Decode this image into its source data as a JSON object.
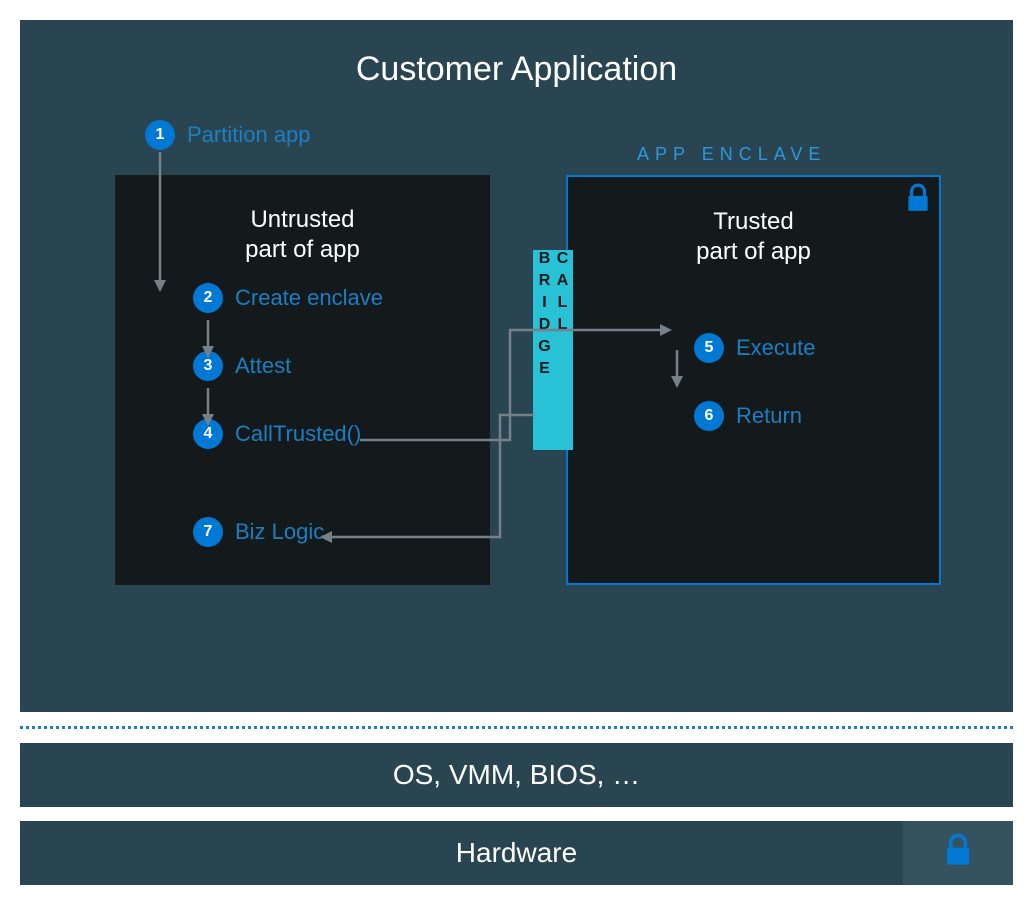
{
  "title": "Customer Application",
  "partition": {
    "num": "1",
    "label": "Partition app"
  },
  "untrusted": {
    "title_line1": "Untrusted",
    "title_line2": "part of app",
    "steps": [
      {
        "num": "2",
        "label": "Create enclave"
      },
      {
        "num": "3",
        "label": "Attest"
      },
      {
        "num": "4",
        "label": "CallTrusted()"
      },
      {
        "num": "7",
        "label": "Biz Logic"
      }
    ]
  },
  "trusted": {
    "enclave_label": "APP ENCLAVE",
    "title_line1": "Trusted",
    "title_line2": "part of app",
    "steps": [
      {
        "num": "5",
        "label": "Execute"
      },
      {
        "num": "6",
        "label": "Return"
      }
    ]
  },
  "bridge_label": "CALL BRIDGE",
  "os_bar": "OS, VMM, BIOS, …",
  "hardware_bar": "Hardware"
}
